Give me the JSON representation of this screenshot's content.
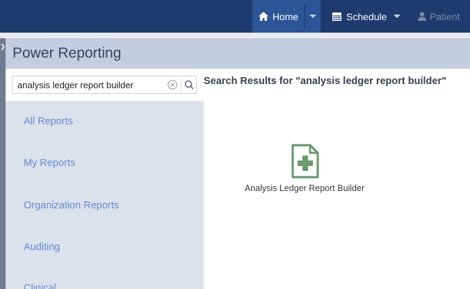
{
  "navbar": {
    "home_label": "Home",
    "schedule_label": "Schedule",
    "patient_label": "Patient"
  },
  "page": {
    "title": "Power Reporting"
  },
  "search": {
    "value": "analysis ledger report builder"
  },
  "sidebar": {
    "items": [
      {
        "label": "All Reports"
      },
      {
        "label": "My Reports"
      },
      {
        "label": "Organization Reports"
      },
      {
        "label": "Auditing"
      },
      {
        "label": "Clinical"
      }
    ]
  },
  "results": {
    "heading": "Search Results for \"analysis ledger report builder\"",
    "items": [
      {
        "label": "Analysis Ledger Report Builder",
        "icon": "file-plus-icon"
      }
    ]
  },
  "colors": {
    "navbar": "#1f3a6e",
    "home_active": "#2c5597",
    "title_bar": "#c2cedf",
    "sidebar": "#dde1ea",
    "link": "#5e8ed6",
    "report_icon": "#6a9a6e"
  }
}
